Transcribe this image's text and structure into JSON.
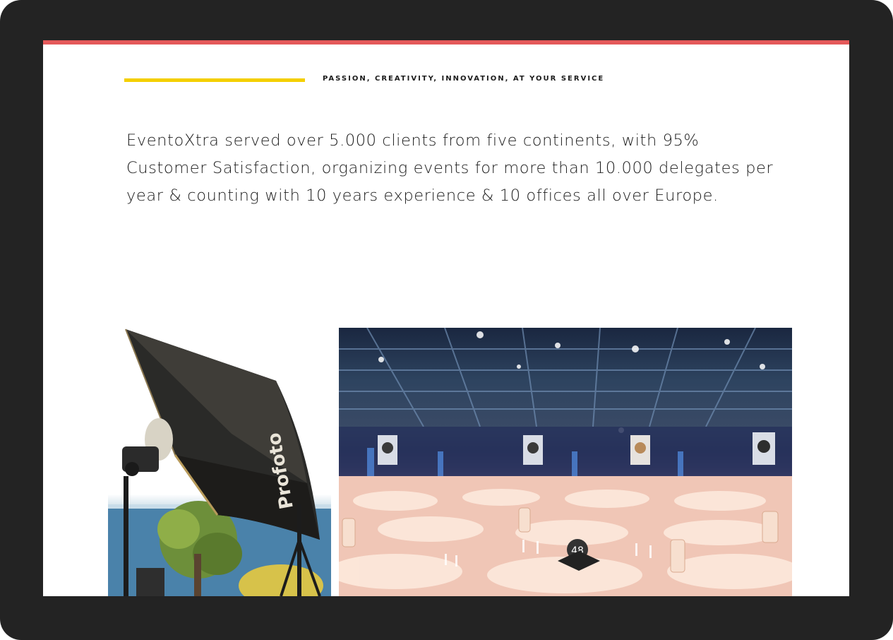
{
  "header": {
    "tagline": "PASSION, CREATIVITY, INNOVATION, AT YOUR SERVICE"
  },
  "intro": {
    "text": "EventoXtra served over 5.000 clients from five continents, with 95% Customer Satisfaction, organizing events for more than 10.000 delegates per year & counting with 10 years experience & 10 offices all over Europe."
  },
  "gallery": {
    "umbrella_brand": "Profoto",
    "table_number": "48"
  },
  "colors": {
    "accent_bar": "#e4595a",
    "rule": "#f4cf00",
    "frame": "#232323"
  }
}
